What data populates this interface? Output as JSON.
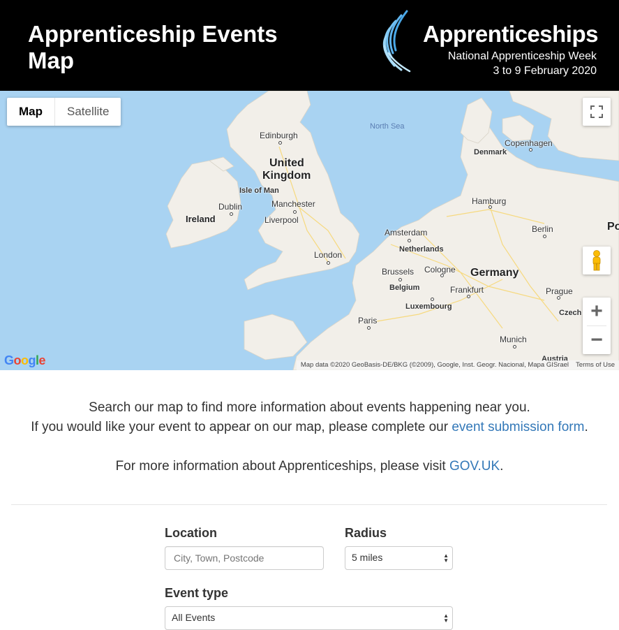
{
  "header": {
    "title": "Apprenticeship Events Map",
    "brand_name": "Apprenticeships",
    "brand_line1": "National Apprenticeship Week",
    "brand_line2": "3 to 9 February 2020"
  },
  "map": {
    "type_buttons": [
      "Map",
      "Satellite"
    ],
    "active_type": "Map",
    "labels": {
      "north_sea": "North Sea",
      "edinburgh": "Edinburgh",
      "united": "United",
      "kingdom": "Kingdom",
      "isle_of_man": "Isle of Man",
      "dublin": "Dublin",
      "ireland": "Ireland",
      "manchester": "Manchester",
      "liverpool": "Liverpool",
      "london": "London",
      "denmark": "Denmark",
      "copenhagen": "Copenhagen",
      "hamburg": "Hamburg",
      "berlin": "Berlin",
      "amsterdam": "Amsterdam",
      "netherlands": "Netherlands",
      "brussels": "Brussels",
      "cologne": "Cologne",
      "belgium": "Belgium",
      "germany": "Germany",
      "frankfurt": "Frankfurt",
      "prague": "Prague",
      "czech": "Czech",
      "luxembourg": "Luxembourg",
      "paris": "Paris",
      "munich": "Munich",
      "austria": "Austria",
      "po": "Po"
    },
    "attribution": "Map data ©2020 GeoBasis-DE/BKG (©2009), Google, Inst. Geogr. Nacional, Mapa GISrael",
    "terms": "Terms of Use",
    "google": [
      "G",
      "o",
      "o",
      "g",
      "l",
      "e"
    ],
    "zoom_in": "+",
    "zoom_out": "−"
  },
  "info": {
    "line1": "Search our map to find more information about events happening near you.",
    "line2_prefix": "If you would like your event to appear on our map, please complete our ",
    "line2_link": "event submission form",
    "line2_suffix": ".",
    "line3_prefix": "For more information about Apprenticeships, please visit ",
    "line3_link": "GOV.UK",
    "line3_suffix": "."
  },
  "form": {
    "location_label": "Location",
    "location_placeholder": "City, Town, Postcode",
    "radius_label": "Radius",
    "radius_value": "5 miles",
    "event_type_label": "Event type",
    "event_type_value": "All Events"
  }
}
